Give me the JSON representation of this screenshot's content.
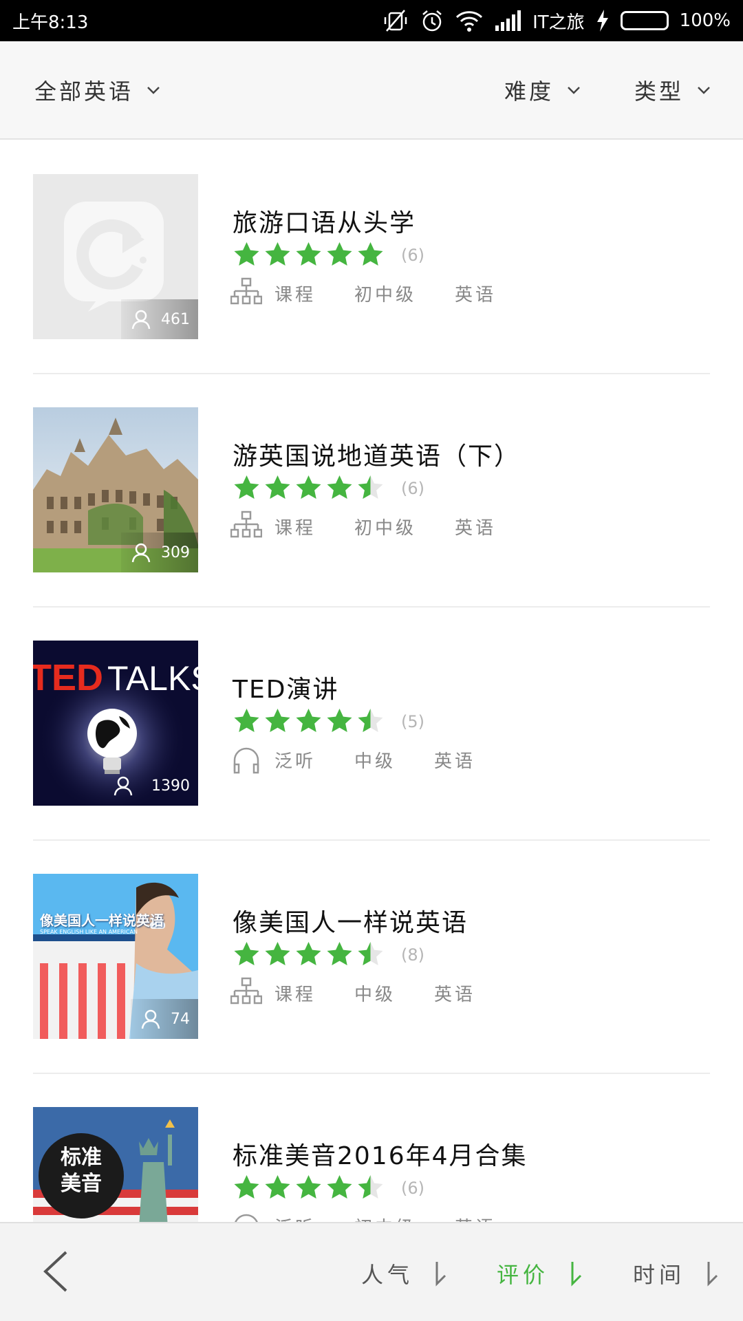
{
  "status_bar": {
    "time": "上午8:13",
    "carrier": "IT之旅",
    "battery": "100%",
    "icons": [
      "muted-vibrate-icon",
      "alarm-icon",
      "wifi-icon",
      "signal-icon",
      "charging-icon",
      "battery-icon"
    ],
    "battery_color": "#3dd63d"
  },
  "filters": {
    "all_label": "全部英语",
    "difficulty_label": "难度",
    "type_label": "类型"
  },
  "courses": [
    {
      "title": "旅游口语从头学",
      "learners": "461",
      "rating_count": "(6)",
      "stars": 5,
      "type": "课程",
      "type_icon": "course-structure-icon",
      "level": "初中级",
      "language": "英语",
      "thumb": "app-placeholder"
    },
    {
      "title": "游英国说地道英语（下）",
      "learners": "309",
      "rating_count": "(6)",
      "stars": 4.5,
      "type": "课程",
      "type_icon": "course-structure-icon",
      "level": "初中级",
      "language": "英语",
      "thumb": "oxford-building"
    },
    {
      "title": "TED演讲",
      "learners": "1390",
      "rating_count": "(5)",
      "stars": 4.5,
      "type": "泛听",
      "type_icon": "headphones-icon",
      "level": "中级",
      "language": "英语",
      "thumb": "ted-talks"
    },
    {
      "title": "像美国人一样说英语",
      "learners": "74",
      "rating_count": "(8)",
      "stars": 4.5,
      "type": "课程",
      "type_icon": "course-structure-icon",
      "level": "中级",
      "language": "英语",
      "thumb": "speak-like-american",
      "thumb_text": "像美国人一样说英语",
      "thumb_subtext": "SPEAK ENGLISH LIKE AN AMERICAN"
    },
    {
      "title": "标准美音2016年4月合集",
      "learners": "",
      "rating_count": "(6)",
      "stars": 4.5,
      "type": "泛听",
      "type_icon": "headphones-icon",
      "level": "初中级",
      "language": "英语",
      "thumb": "standard-american",
      "thumb_text_line1": "标准",
      "thumb_text_line2": "美音"
    }
  ],
  "bottom_bar": {
    "popularity_label": "人气",
    "rating_label": "评价",
    "time_label": "时间",
    "active_color": "#45b540"
  },
  "colors": {
    "star_green": "#45b540",
    "star_empty": "#e6e6e6"
  }
}
